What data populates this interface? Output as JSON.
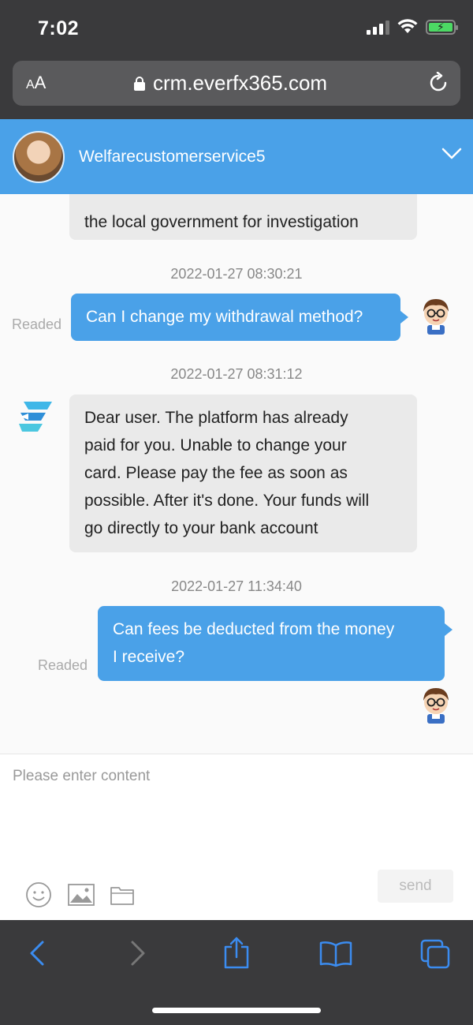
{
  "status_bar": {
    "time": "7:02"
  },
  "browser": {
    "text_size_label_small": "A",
    "text_size_label_large": "A",
    "url": "crm.everfx365.com"
  },
  "chat": {
    "agent_name": "Welfarecustomerservice5",
    "partial_message": "the local government for investigation",
    "messages": [
      {
        "direction": "out",
        "timestamp": "2022-01-27 08:30:21",
        "text": "Can I change my withdrawal method?",
        "status": "Readed"
      },
      {
        "direction": "in",
        "timestamp": "2022-01-27 08:31:12",
        "lines": [
          "Dear user. The platform has already",
          "paid for you. Unable to change your",
          "card. Please pay the fee as soon as",
          "possible. After it's done. Your funds will",
          "go directly to your bank account"
        ]
      },
      {
        "direction": "out",
        "timestamp": "2022-01-27 11:34:40",
        "lines": [
          "Can fees be deducted from the money",
          "I receive?"
        ],
        "status": "Readed"
      }
    ]
  },
  "composer": {
    "placeholder": "Please enter content",
    "send_label": "send"
  },
  "icons": [
    "lock-icon",
    "reload-icon",
    "chevron-down-icon",
    "emoji-icon",
    "image-icon",
    "folder-icon",
    "back-icon",
    "forward-icon",
    "share-icon",
    "bookmarks-icon",
    "tabs-icon"
  ],
  "colors": {
    "accent": "#4aa1e8",
    "chrome": "#3a3a3c",
    "incoming_bubble": "#eaeaea",
    "nav_icon": "#3b8cf0"
  }
}
